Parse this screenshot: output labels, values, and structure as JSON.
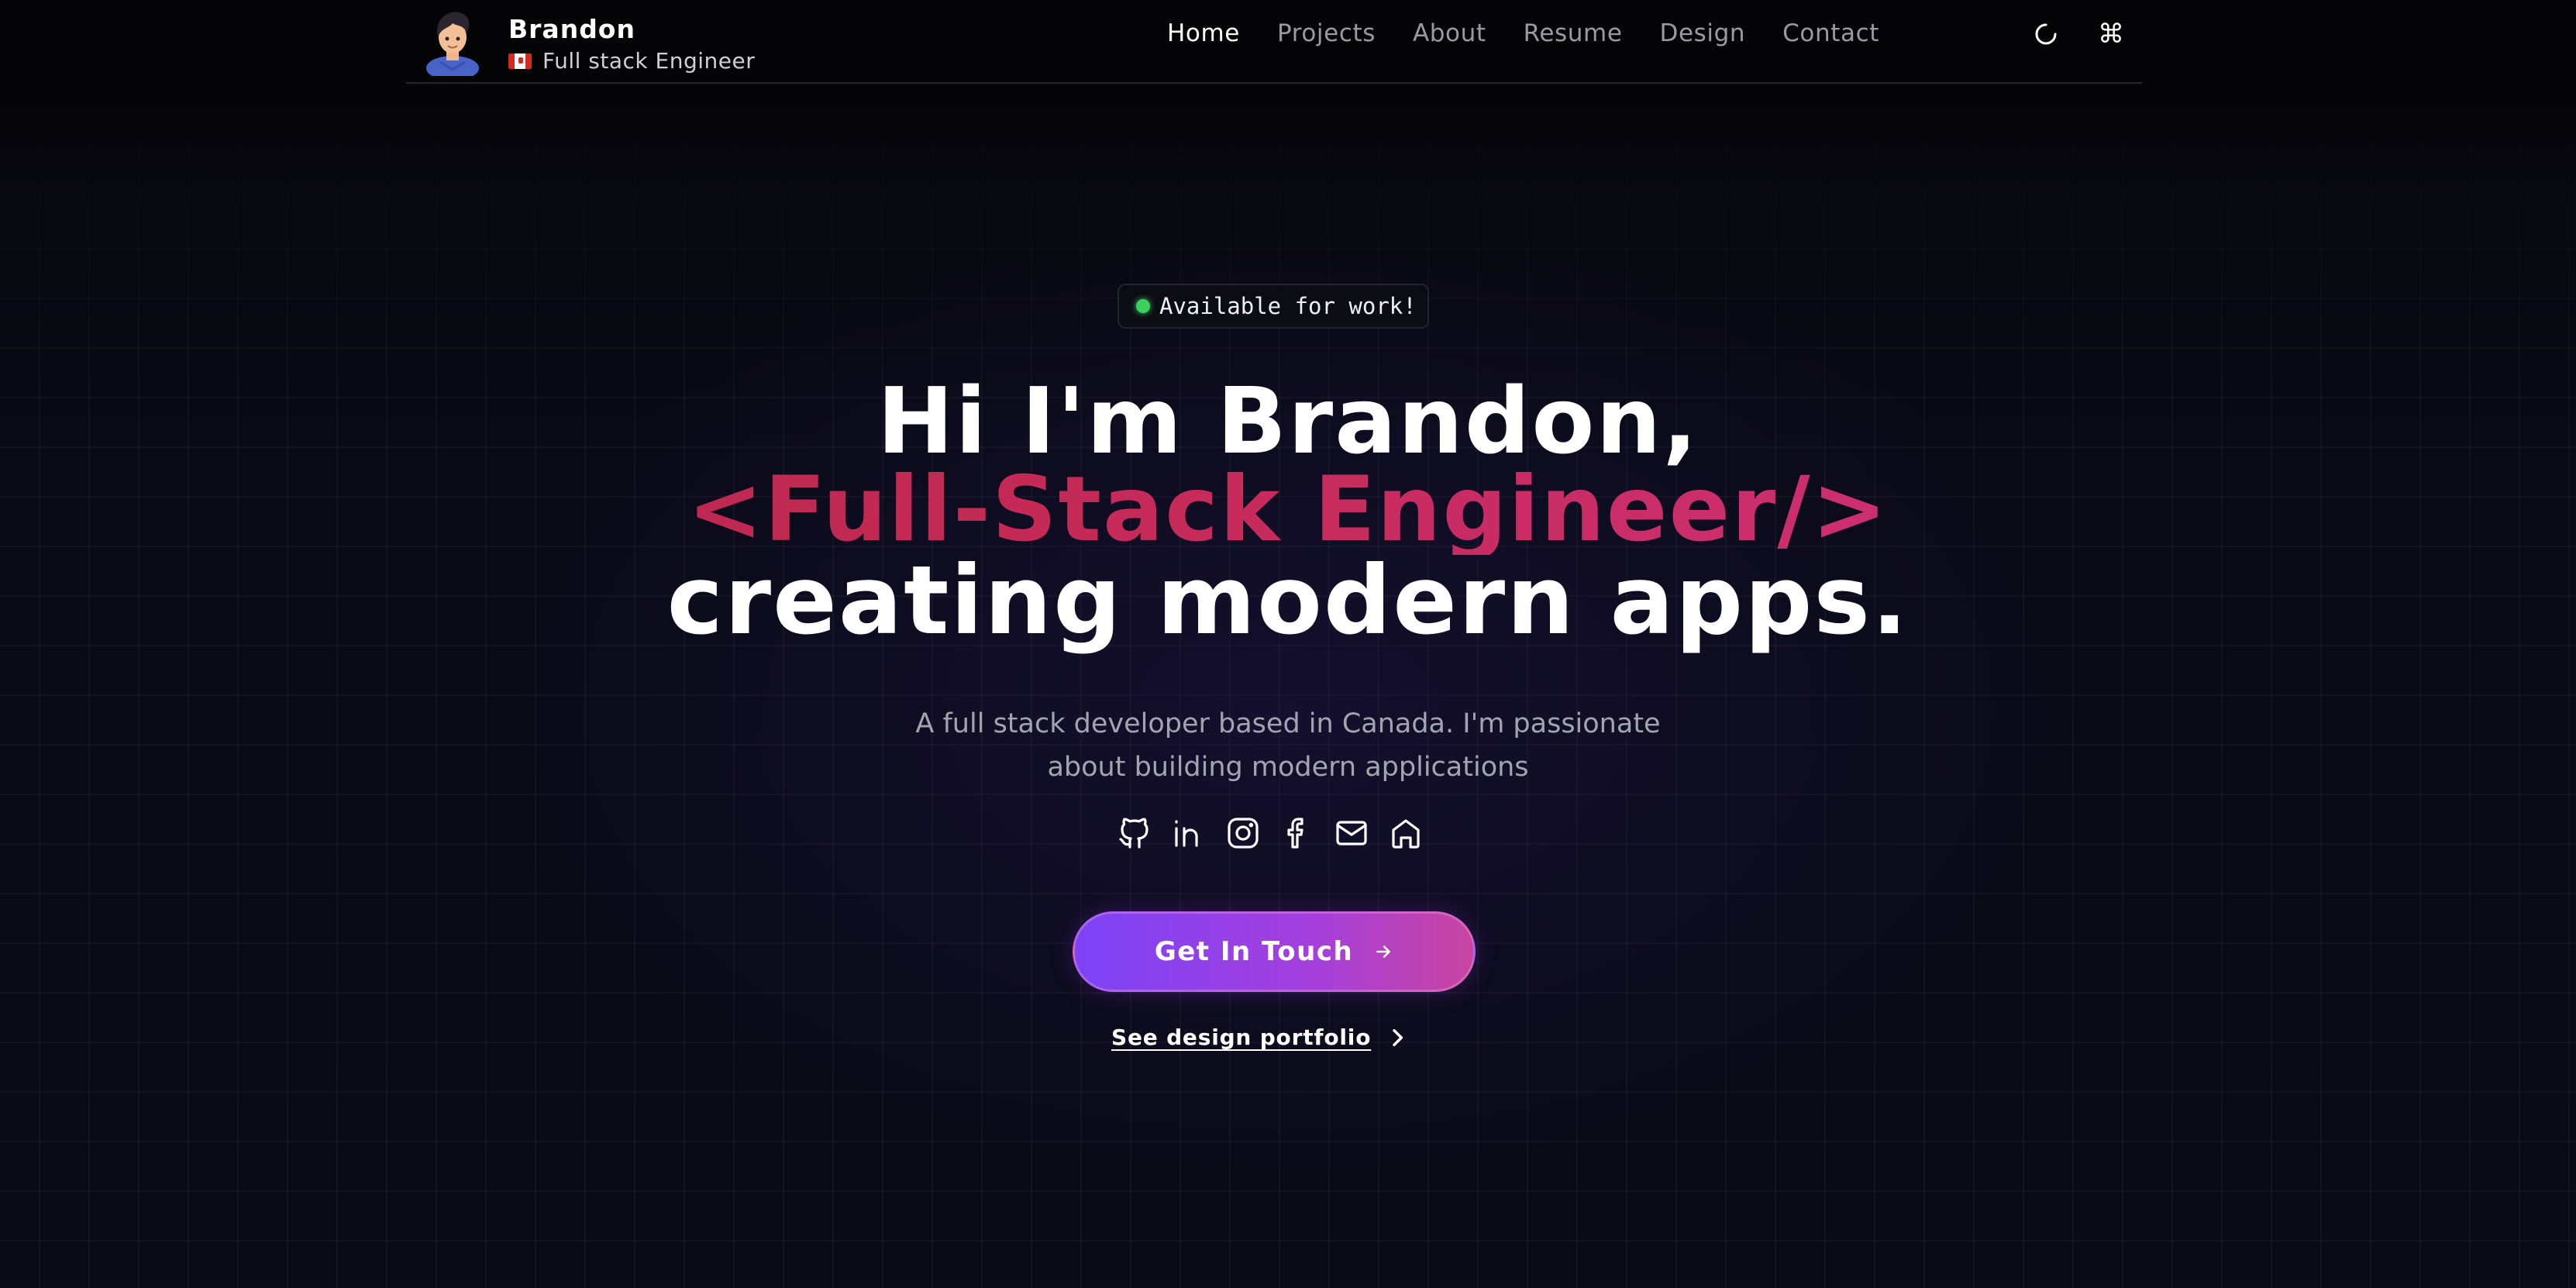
{
  "header": {
    "name": "Brandon",
    "role": "Full stack Engineer",
    "nav": [
      "Home",
      "Projects",
      "About",
      "Resume",
      "Design",
      "Contact"
    ],
    "active_nav": "Home",
    "cmd_glyph": "⌘"
  },
  "hero": {
    "status": "Available for work!",
    "line1": "Hi I'm Brandon,",
    "line2": "<Full-Stack Engineer/>",
    "line3": "creating modern apps.",
    "lead_line1": "A full stack developer based in Canada. I'm passionate",
    "lead_line2": "about building modern applications",
    "cta": "Get In Touch",
    "portfolio_link": "See design portfolio"
  },
  "socials": [
    "github-icon",
    "linkedin-icon",
    "instagram-icon",
    "facebook-icon",
    "mail-icon",
    "home-icon"
  ],
  "colors": {
    "accent_gradient": [
      "#7b43f6",
      "#c8449f"
    ],
    "title_gradient": [
      "#b1254a",
      "#d2348a"
    ],
    "status_dot": "#3ccf5c"
  }
}
